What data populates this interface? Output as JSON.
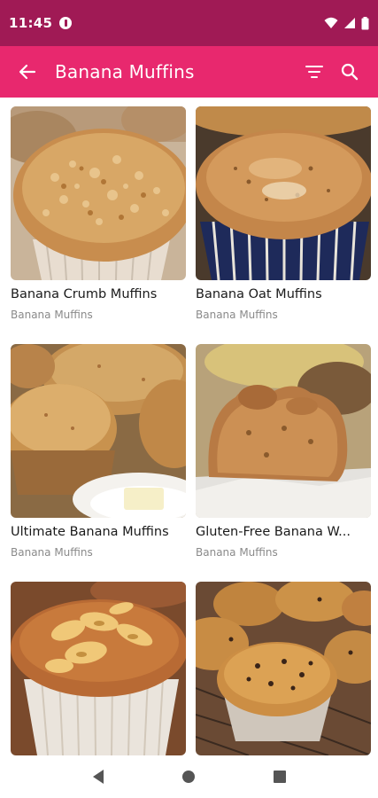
{
  "status_bar": {
    "time": "11:45"
  },
  "app_bar": {
    "title": "Banana Muffins"
  },
  "recipes": [
    {
      "title": "Banana Crumb Muffins",
      "category": "Banana Muffins"
    },
    {
      "title": "Banana Oat Muffins",
      "category": "Banana Muffins"
    },
    {
      "title": "Ultimate Banana Muffins",
      "category": "Banana Muffins"
    },
    {
      "title": "Gluten-Free Banana W...",
      "category": "Banana Muffins"
    },
    {
      "title": "",
      "category": ""
    },
    {
      "title": "",
      "category": ""
    }
  ],
  "colors": {
    "status_bar": "#a01a55",
    "app_bar": "#e8286e"
  },
  "icons": {
    "status": [
      "app-notification-icon",
      "wifi-icon",
      "signal-icon",
      "battery-icon"
    ],
    "app_bar": [
      "back-arrow-icon",
      "filter-icon",
      "search-icon"
    ],
    "nav": [
      "back-triangle-icon",
      "home-circle-icon",
      "recents-square-icon"
    ]
  }
}
